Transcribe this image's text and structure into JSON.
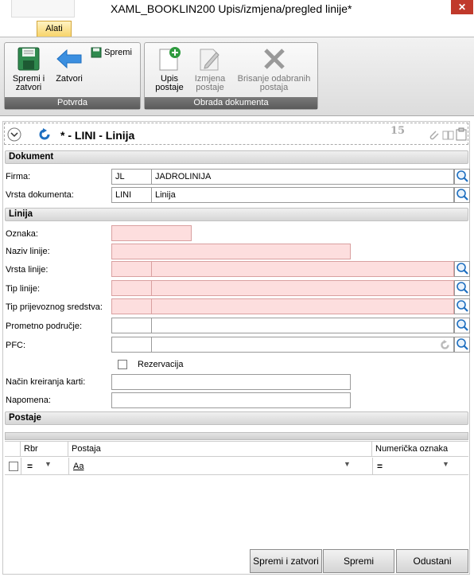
{
  "window": {
    "title": "XAML_BOOKLIN200  Upis/izmjena/pregled linije*",
    "close": "✕"
  },
  "ribbon": {
    "tab": "Alati",
    "groups": [
      {
        "label": "Potvrda"
      },
      {
        "label": "Obrada dokumenta"
      }
    ],
    "buttons": {
      "save_close": "Spremi i zatvori",
      "close": "Zatvori",
      "save": "Spremi",
      "add_stop": "Upis postaje",
      "edit_stop": "Izmjena postaje",
      "delete_stops": "Brisanje odabranih postaja"
    }
  },
  "header": {
    "title": "* - LINI - Linija",
    "number": "15"
  },
  "sections": {
    "dokument": "Dokument",
    "linija": "Linija",
    "postaje": "Postaje"
  },
  "fields": {
    "firma": {
      "label": "Firma:",
      "code": "JL",
      "name": "JADROLINIJA"
    },
    "vrsta_dokumenta": {
      "label": "Vrsta dokumenta:",
      "code": "LINI",
      "name": "Linija"
    },
    "oznaka": {
      "label": "Oznaka:"
    },
    "naziv_linije": {
      "label": "Naziv linije:"
    },
    "vrsta_linije": {
      "label": "Vrsta linije:"
    },
    "tip_linije": {
      "label": "Tip linije:"
    },
    "tip_prijevoznog": {
      "label": "Tip prijevoznog sredstva:"
    },
    "prometno_podrucje": {
      "label": "Prometno područje:"
    },
    "pfc": {
      "label": "PFC:"
    },
    "rezervacija": {
      "label": "Rezervacija",
      "checked": false
    },
    "nacin_kreiranja": {
      "label": "Način kreiranja karti:"
    },
    "napomena": {
      "label": "Napomena:"
    }
  },
  "grid": {
    "columns": [
      "Rbr",
      "Postaja",
      "Numerička oznaka"
    ],
    "filter_row": {
      "rbr_op": "=",
      "postaja_op": "Aa",
      "num_op": "="
    }
  },
  "footer": {
    "save_close": "Spremi i zatvori",
    "save": "Spremi",
    "cancel": "Odustani"
  },
  "colors": {
    "required": "#fddede",
    "accent": "#1e6fc0",
    "tab": "#f7d46a"
  }
}
